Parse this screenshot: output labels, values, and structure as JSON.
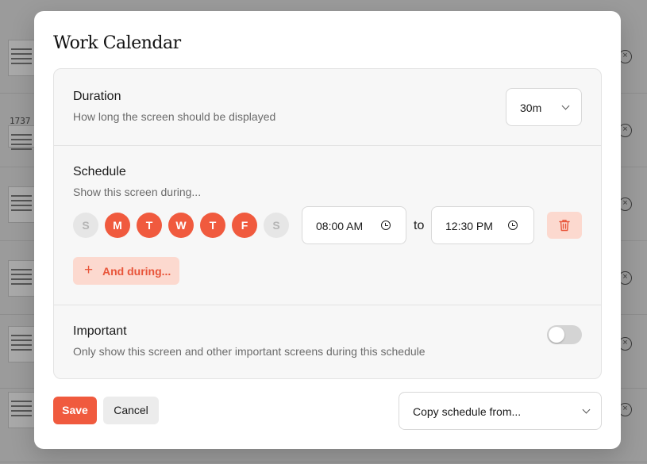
{
  "background": {
    "thumb_text": "1737"
  },
  "dialog": {
    "title": "Work Calendar",
    "duration": {
      "title": "Duration",
      "description": "How long the screen should be displayed",
      "selected": "30m"
    },
    "schedule": {
      "title": "Schedule",
      "description": "Show this screen during...",
      "days": [
        {
          "label": "S",
          "active": false
        },
        {
          "label": "M",
          "active": true
        },
        {
          "label": "T",
          "active": true
        },
        {
          "label": "W",
          "active": true
        },
        {
          "label": "T",
          "active": true
        },
        {
          "label": "F",
          "active": true
        },
        {
          "label": "S",
          "active": false
        }
      ],
      "start_time": "08:00 AM",
      "to_label": "to",
      "end_time": "12:30 PM",
      "add_label": "And during..."
    },
    "important": {
      "title": "Important",
      "description": "Only show this screen and other important screens during this schedule",
      "enabled": false
    },
    "footer": {
      "save_label": "Save",
      "cancel_label": "Cancel",
      "copy_placeholder": "Copy schedule from..."
    }
  },
  "colors": {
    "accent": "#f05a3e",
    "accent_soft": "#fcd9cf",
    "inactive_day": "#e6e6e6"
  }
}
